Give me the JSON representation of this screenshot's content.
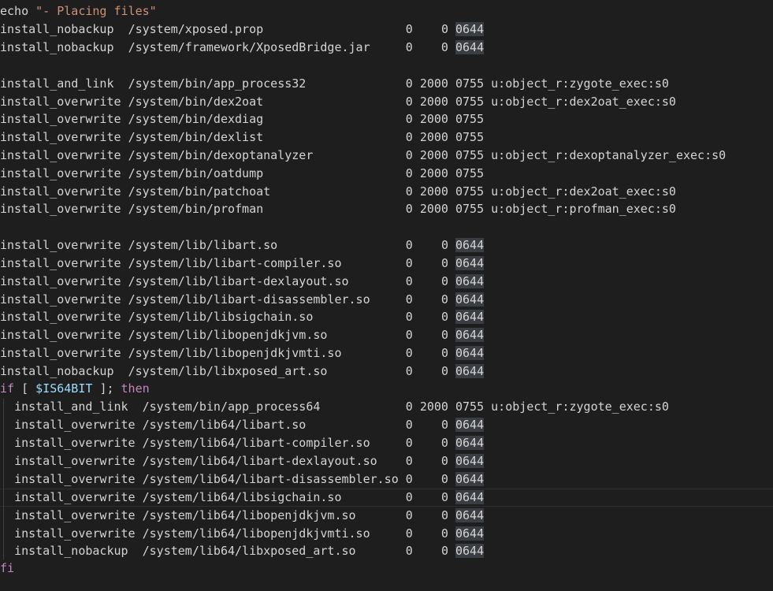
{
  "echo": {
    "cmd": "echo",
    "text": "\"- Placing files\""
  },
  "lines": [
    {
      "cmd": "install_nobackup",
      "path": "/system/xposed.prop",
      "uid": "0",
      "gid": "0",
      "mode": "0644",
      "ctx": ""
    },
    {
      "cmd": "install_nobackup",
      "path": "/system/framework/XposedBridge.jar",
      "uid": "0",
      "gid": "0",
      "mode": "0644",
      "ctx": ""
    },
    {
      "cmd": "install_and_link",
      "path": "/system/bin/app_process32",
      "uid": "0",
      "gid": "2000",
      "mode": "0755",
      "ctx": "u:object_r:zygote_exec:s0"
    },
    {
      "cmd": "install_overwrite",
      "path": "/system/bin/dex2oat",
      "uid": "0",
      "gid": "2000",
      "mode": "0755",
      "ctx": "u:object_r:dex2oat_exec:s0"
    },
    {
      "cmd": "install_overwrite",
      "path": "/system/bin/dexdiag",
      "uid": "0",
      "gid": "2000",
      "mode": "0755",
      "ctx": ""
    },
    {
      "cmd": "install_overwrite",
      "path": "/system/bin/dexlist",
      "uid": "0",
      "gid": "2000",
      "mode": "0755",
      "ctx": ""
    },
    {
      "cmd": "install_overwrite",
      "path": "/system/bin/dexoptanalyzer",
      "uid": "0",
      "gid": "2000",
      "mode": "0755",
      "ctx": "u:object_r:dexoptanalyzer_exec:s0"
    },
    {
      "cmd": "install_overwrite",
      "path": "/system/bin/oatdump",
      "uid": "0",
      "gid": "2000",
      "mode": "0755",
      "ctx": ""
    },
    {
      "cmd": "install_overwrite",
      "path": "/system/bin/patchoat",
      "uid": "0",
      "gid": "2000",
      "mode": "0755",
      "ctx": "u:object_r:dex2oat_exec:s0"
    },
    {
      "cmd": "install_overwrite",
      "path": "/system/bin/profman",
      "uid": "0",
      "gid": "2000",
      "mode": "0755",
      "ctx": "u:object_r:profman_exec:s0"
    },
    {
      "cmd": "install_overwrite",
      "path": "/system/lib/libart.so",
      "uid": "0",
      "gid": "0",
      "mode": "0644",
      "ctx": ""
    },
    {
      "cmd": "install_overwrite",
      "path": "/system/lib/libart-compiler.so",
      "uid": "0",
      "gid": "0",
      "mode": "0644",
      "ctx": ""
    },
    {
      "cmd": "install_overwrite",
      "path": "/system/lib/libart-dexlayout.so",
      "uid": "0",
      "gid": "0",
      "mode": "0644",
      "ctx": ""
    },
    {
      "cmd": "install_overwrite",
      "path": "/system/lib/libart-disassembler.so",
      "uid": "0",
      "gid": "0",
      "mode": "0644",
      "ctx": ""
    },
    {
      "cmd": "install_overwrite",
      "path": "/system/lib/libsigchain.so",
      "uid": "0",
      "gid": "0",
      "mode": "0644",
      "ctx": ""
    },
    {
      "cmd": "install_overwrite",
      "path": "/system/lib/libopenjdkjvm.so",
      "uid": "0",
      "gid": "0",
      "mode": "0644",
      "ctx": ""
    },
    {
      "cmd": "install_overwrite",
      "path": "/system/lib/libopenjdkjvmti.so",
      "uid": "0",
      "gid": "0",
      "mode": "0644",
      "ctx": ""
    },
    {
      "cmd": "install_nobackup",
      "path": "/system/lib/libxposed_art.so",
      "uid": "0",
      "gid": "0",
      "mode": "0644",
      "ctx": ""
    },
    {
      "cmd": "install_and_link",
      "path": "/system/bin/app_process64",
      "uid": "0",
      "gid": "2000",
      "mode": "0755",
      "ctx": "u:object_r:zygote_exec:s0"
    },
    {
      "cmd": "install_overwrite",
      "path": "/system/lib64/libart.so",
      "uid": "0",
      "gid": "0",
      "mode": "0644",
      "ctx": ""
    },
    {
      "cmd": "install_overwrite",
      "path": "/system/lib64/libart-compiler.so",
      "uid": "0",
      "gid": "0",
      "mode": "0644",
      "ctx": ""
    },
    {
      "cmd": "install_overwrite",
      "path": "/system/lib64/libart-dexlayout.so",
      "uid": "0",
      "gid": "0",
      "mode": "0644",
      "ctx": ""
    },
    {
      "cmd": "install_overwrite",
      "path": "/system/lib64/libart-disassembler.so",
      "uid": "0",
      "gid": "0",
      "mode": "0644",
      "ctx": ""
    },
    {
      "cmd": "install_overwrite",
      "path": "/system/lib64/libsigchain.so",
      "uid": "0",
      "gid": "0",
      "mode": "0644",
      "ctx": ""
    },
    {
      "cmd": "install_overwrite",
      "path": "/system/lib64/libopenjdkjvm.so",
      "uid": "0",
      "gid": "0",
      "mode": "0644",
      "ctx": ""
    },
    {
      "cmd": "install_overwrite",
      "path": "/system/lib64/libopenjdkjvmti.so",
      "uid": "0",
      "gid": "0",
      "mode": "0644",
      "ctx": ""
    },
    {
      "cmd": "install_nobackup",
      "path": "/system/lib64/libxposed_art.so",
      "uid": "0",
      "gid": "0",
      "mode": "0644",
      "ctx": ""
    }
  ],
  "if_line": {
    "kw_if": "if",
    "open": "[",
    "var": "$IS64BIT",
    "close": "];",
    "kw_then": "then"
  },
  "fi": "fi",
  "colors": {
    "background": "#1e1e1e",
    "text": "#d4d4d4",
    "keyword": "#c586c0",
    "string": "#ce9178",
    "variable": "#9cdcfe",
    "mode_highlight": "#3a3d41"
  }
}
